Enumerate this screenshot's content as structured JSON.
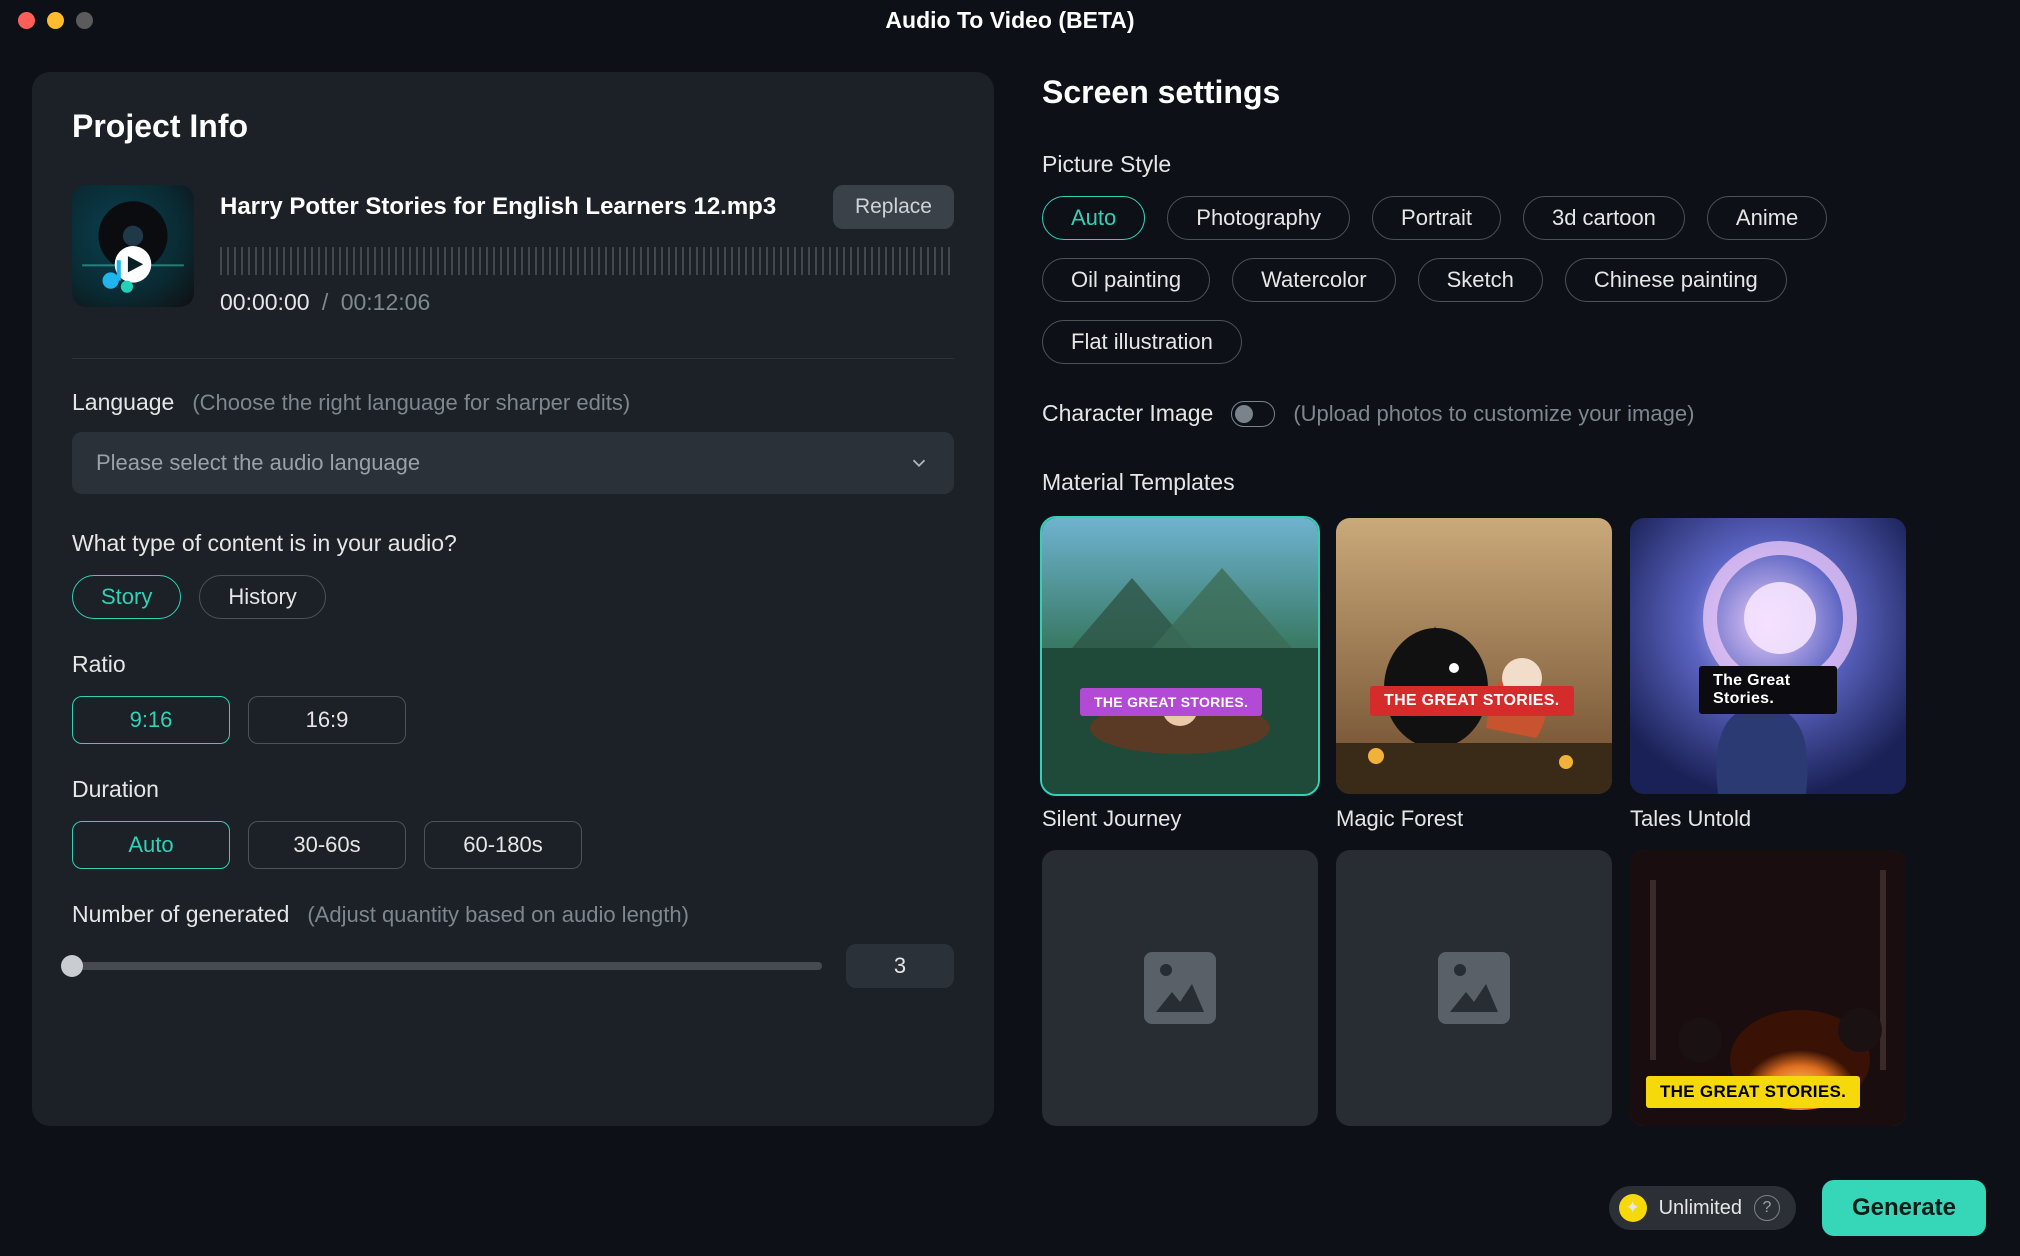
{
  "app_title": "Audio To Video (BETA)",
  "project_info": {
    "title": "Project Info",
    "filename": "Harry Potter Stories for English Learners 12.mp3",
    "replace_label": "Replace",
    "time_current": "00:00:00",
    "time_separator": "/",
    "time_duration": "00:12:06",
    "language": {
      "label": "Language",
      "hint": "(Choose the right language for sharper edits)",
      "placeholder": "Please select the audio language"
    },
    "content_type": {
      "label": "What type of content is in your audio?",
      "options": [
        "Story",
        "History"
      ],
      "selected": "Story"
    },
    "ratio": {
      "label": "Ratio",
      "options": [
        "9:16",
        "16:9"
      ],
      "selected": "9:16"
    },
    "duration": {
      "label": "Duration",
      "options": [
        "Auto",
        "30-60s",
        "60-180s"
      ],
      "selected": "Auto"
    },
    "number_generated": {
      "label": "Number of generated",
      "hint": "(Adjust quantity based on audio length)",
      "value": "3"
    }
  },
  "screen_settings": {
    "title": "Screen settings",
    "picture_style": {
      "label": "Picture Style",
      "options": [
        "Auto",
        "Photography",
        "Portrait",
        "3d cartoon",
        "Anime",
        "Oil painting",
        "Watercolor",
        "Sketch",
        "Chinese painting",
        "Flat illustration"
      ],
      "selected": "Auto"
    },
    "character_image": {
      "label": "Character Image",
      "hint": "(Upload photos to customize your image)",
      "enabled": false
    },
    "material_templates": {
      "label": "Material Templates",
      "items": [
        {
          "name": "Silent Journey",
          "banner": "THE GREAT STORIES.",
          "selected": true
        },
        {
          "name": "Magic Forest",
          "banner": "THE GREAT STORIES."
        },
        {
          "name": "Tales Untold",
          "banner": "The Great Stories."
        },
        {
          "name": "",
          "banner": ""
        },
        {
          "name": "",
          "banner": ""
        },
        {
          "name": "",
          "banner": "THE GREAT STORIES."
        }
      ]
    }
  },
  "footer": {
    "unlimited_label": "Unlimited",
    "generate_label": "Generate"
  }
}
